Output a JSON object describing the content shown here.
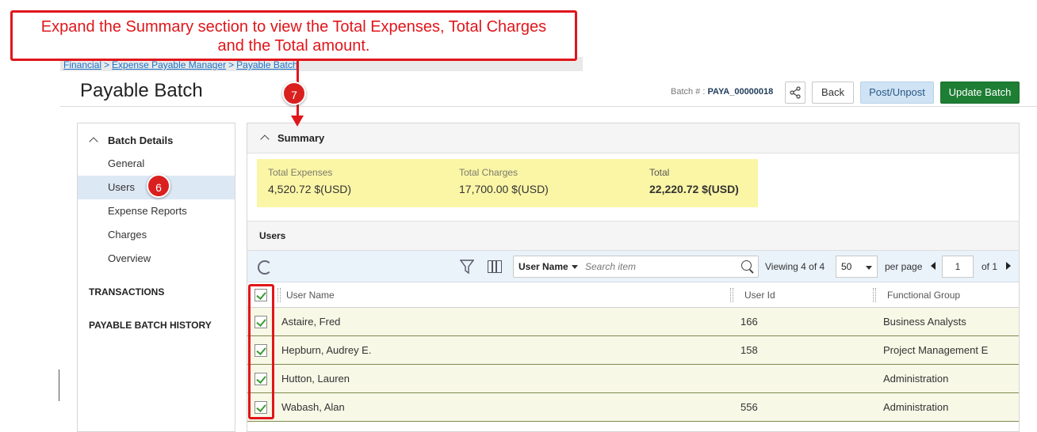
{
  "callout": {
    "line1": "Expand the Summary section to view the Total Expenses, Total Charges",
    "line2": "and the Total amount."
  },
  "badges": {
    "step7": "7",
    "step6": "6"
  },
  "breadcrumb": {
    "items": [
      "Financial",
      "Expense Payable Manager",
      "Payable Batch"
    ],
    "separator": ">"
  },
  "header": {
    "title": "Payable Batch",
    "batch_label": "Batch # :",
    "batch_number": "PAYA_00000018",
    "back_label": "Back",
    "post_label": "Post/Unpost",
    "update_label": "Update Batch"
  },
  "leftnav": {
    "section_title": "Batch Details",
    "items": [
      "General",
      "Users",
      "Expense Reports",
      "Charges",
      "Overview"
    ],
    "active": "Users",
    "transactions": "TRANSACTIONS",
    "history": "PAYABLE BATCH HISTORY"
  },
  "summary": {
    "title": "Summary",
    "total_expenses_label": "Total Expenses",
    "total_expenses_value": "4,520.72 $(USD)",
    "total_charges_label": "Total Charges",
    "total_charges_value": "17,700.00 $(USD)",
    "total_label": "Total",
    "total_value": "22,220.72 $(USD)"
  },
  "users": {
    "title": "Users",
    "search_field": "User Name",
    "search_placeholder": "Search item",
    "viewing_prefix": "Viewing",
    "viewing_count": "4 of 4",
    "per_page_value": "50",
    "per_page_label": "per page",
    "page_value": "1",
    "page_of": "of 1",
    "columns": [
      "User Name",
      "User Id",
      "Functional Group"
    ],
    "rows": [
      {
        "name": "Astaire, Fred",
        "id": "166",
        "group": "Business Analysts"
      },
      {
        "name": "Hepburn, Audrey E.",
        "id": "158",
        "group": "Project Management E"
      },
      {
        "name": "Hutton, Lauren",
        "id": "",
        "group": "Administration"
      },
      {
        "name": "Wabash, Alan",
        "id": "556",
        "group": "Administration"
      }
    ]
  },
  "colors": {
    "accent_red": "#e0161b",
    "update_green": "#1e7e34",
    "summary_yellow": "#fbf6a6"
  }
}
